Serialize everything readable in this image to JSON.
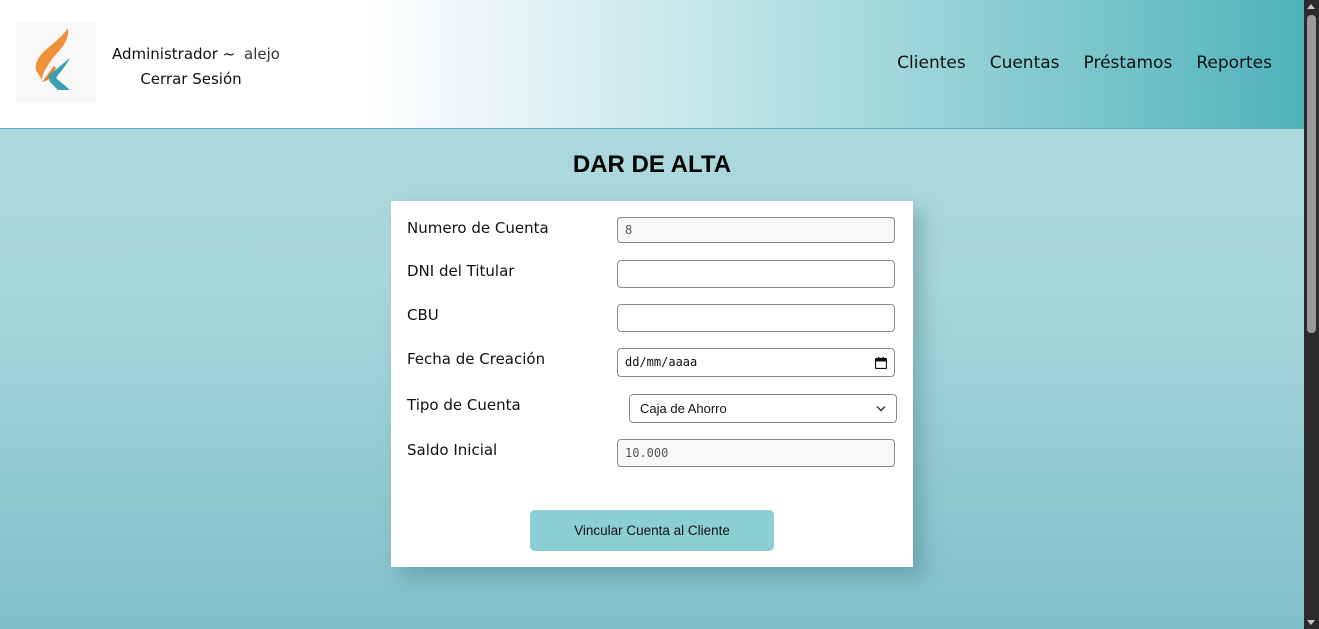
{
  "header": {
    "role": "Administrador ~",
    "username": "alejo",
    "logout_label": "Cerrar Sesión",
    "logo_icon": "brand-k-logo-icon",
    "colors": {
      "logo_orange": "#f0913a",
      "logo_teal": "#3a9fae"
    }
  },
  "nav": {
    "items": [
      "Clientes",
      "Cuentas",
      "Préstamos",
      "Reportes"
    ]
  },
  "page": {
    "title": "DAR DE ALTA"
  },
  "form": {
    "account_number": {
      "label": "Numero de Cuenta",
      "value": "8"
    },
    "dni": {
      "label": "DNI del Titular",
      "value": ""
    },
    "cbu": {
      "label": "CBU",
      "value": ""
    },
    "creation_date": {
      "label": "Fecha de Creación",
      "placeholder": "dd/mm/aaaa",
      "icon": "calendar-icon"
    },
    "account_type": {
      "label": "Tipo de Cuenta",
      "selected": "Caja de Ahorro",
      "icon": "chevron-down-icon"
    },
    "initial_balance": {
      "label": "Saldo Inicial",
      "value": "10.000"
    },
    "submit_label": "Vincular Cuenta al Cliente",
    "colors": {
      "button": "#8ccfd3"
    }
  }
}
